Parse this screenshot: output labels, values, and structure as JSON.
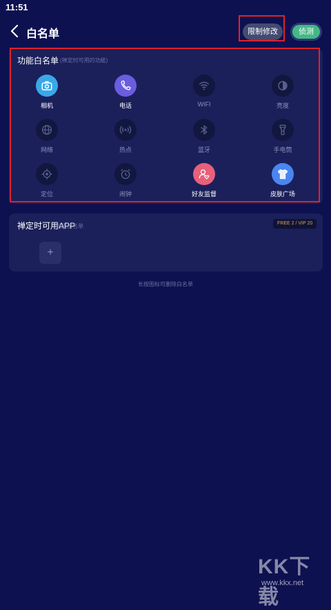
{
  "status": {
    "time": "11:51"
  },
  "header": {
    "title": "白名单",
    "limit_label": "限制修改",
    "pill_label": "侦测"
  },
  "function_card": {
    "title": "功能白名单",
    "subtitle": "(禅定时可用的功能)",
    "items": [
      {
        "label": "相机",
        "icon": "camera-icon",
        "active": true
      },
      {
        "label": "电话",
        "icon": "phone-icon",
        "active": true
      },
      {
        "label": "WIFI",
        "icon": "wifi-icon",
        "active": false
      },
      {
        "label": "亮度",
        "icon": "brightness-icon",
        "active": false
      },
      {
        "label": "网络",
        "icon": "network-icon",
        "active": false
      },
      {
        "label": "热点",
        "icon": "hotspot-icon",
        "active": false
      },
      {
        "label": "蓝牙",
        "icon": "bluetooth-icon",
        "active": false
      },
      {
        "label": "手电筒",
        "icon": "flashlight-icon",
        "active": false
      },
      {
        "label": "定位",
        "icon": "location-icon",
        "active": false
      },
      {
        "label": "闹钟",
        "icon": "alarm-icon",
        "active": false
      },
      {
        "label": "好友监督",
        "icon": "friend-supervise-icon",
        "active": true
      },
      {
        "label": "皮肤广场",
        "icon": "skin-shirt-icon",
        "active": true
      }
    ]
  },
  "app_card": {
    "title": "禅定时可用APP",
    "subtitle": "可添加名单",
    "badge": "FREE 2 / VIP 20",
    "add_label": "+"
  },
  "hint": "长按图标可删除白名单",
  "watermark": {
    "logo": "KK下载",
    "url": "www.kkx.net"
  }
}
